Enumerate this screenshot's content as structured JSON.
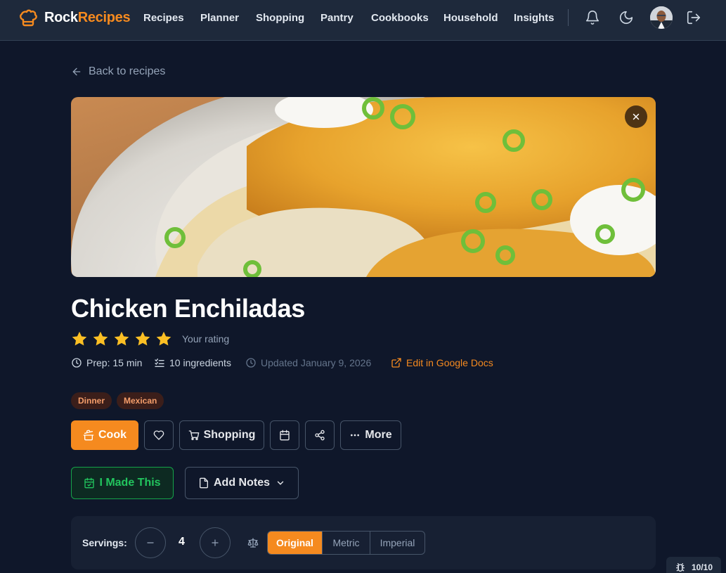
{
  "app": {
    "brand_part1": "Rock",
    "brand_part2": "Recipes",
    "accent_color": "#f58a1f"
  },
  "nav": {
    "items": [
      "Recipes",
      "Planner",
      "Shopping",
      "Pantry",
      "Cookbooks",
      "Household",
      "Insights"
    ],
    "icons": [
      "bell-icon",
      "moon-icon",
      "avatar",
      "logout-icon"
    ]
  },
  "back_link": "Back to recipes",
  "recipe": {
    "title": "Chicken Enchiladas",
    "rating": 5,
    "rating_max": 5,
    "rating_label": "Your rating",
    "prep": "Prep: 15 min",
    "ingredients": "10 ingredients",
    "updated": "Updated January 9, 2026",
    "edit_link": "Edit in Google Docs",
    "tags": [
      "Dinner",
      "Mexican"
    ]
  },
  "actions": {
    "cook": "Cook",
    "shopping": "Shopping",
    "more": "More",
    "made_this": "I Made This",
    "add_notes": "Add Notes"
  },
  "servings": {
    "label": "Servings:",
    "count": "4",
    "units": [
      "Original",
      "Metric",
      "Imperial"
    ],
    "selected_unit": "Original"
  },
  "debug_badge": "10/10"
}
